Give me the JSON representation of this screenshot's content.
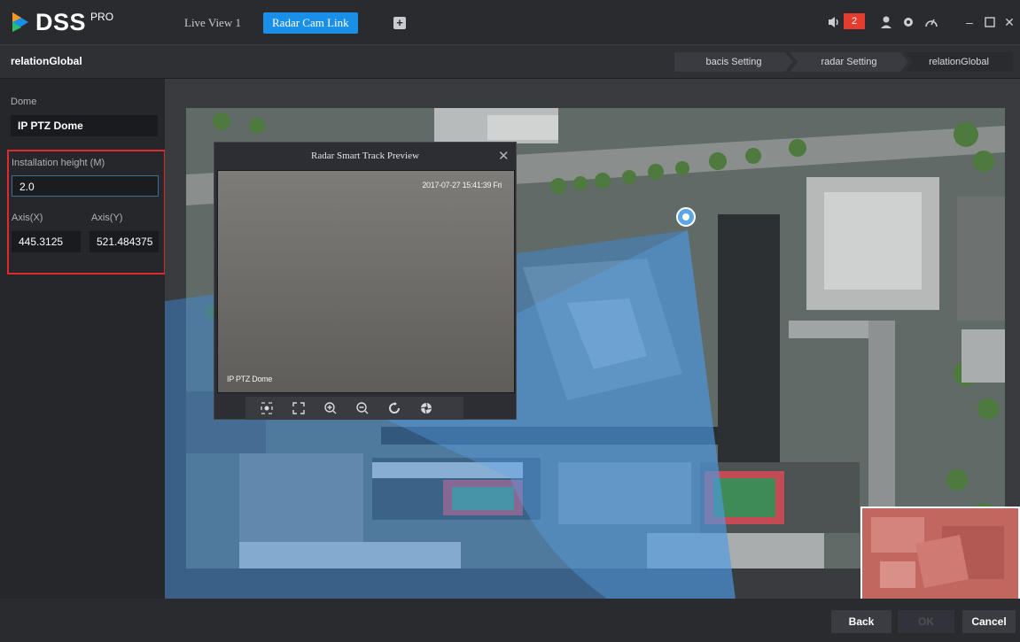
{
  "app": {
    "brand": "DSS",
    "brand_suffix": "PRO"
  },
  "tabs": [
    {
      "label": "Live View 1",
      "active": false
    },
    {
      "label": "Radar Cam Link",
      "active": true
    }
  ],
  "titlebar": {
    "alarm_count": "2",
    "accent_color": "#1a8fe8",
    "badge_color": "#e53c2f"
  },
  "subheader": {
    "title": "relationGlobal",
    "steps": [
      "bacis Setting",
      "radar Setting",
      "relationGlobal"
    ]
  },
  "leftpanel": {
    "dome_label": "Dome",
    "dome_value": "IP PTZ Dome",
    "height_label": "Installation height (M)",
    "height_value": "2.0",
    "axis_x_label": "Axis(X)",
    "axis_y_label": "Axis(Y)",
    "axis_x_value": "445.3125",
    "axis_y_value": "521.484375"
  },
  "preview": {
    "title": "Radar Smart Track Preview",
    "timestamp": "2017-07-27 15:41:39 Fri",
    "camera_label": "IP PTZ Dome",
    "tools": [
      "snapshot-icon",
      "fullscreen-icon",
      "zoom-in-icon",
      "zoom-out-icon",
      "refresh-icon",
      "aperture-icon"
    ]
  },
  "buttons": {
    "back": "Back",
    "ok": "OK",
    "cancel": "Cancel"
  }
}
